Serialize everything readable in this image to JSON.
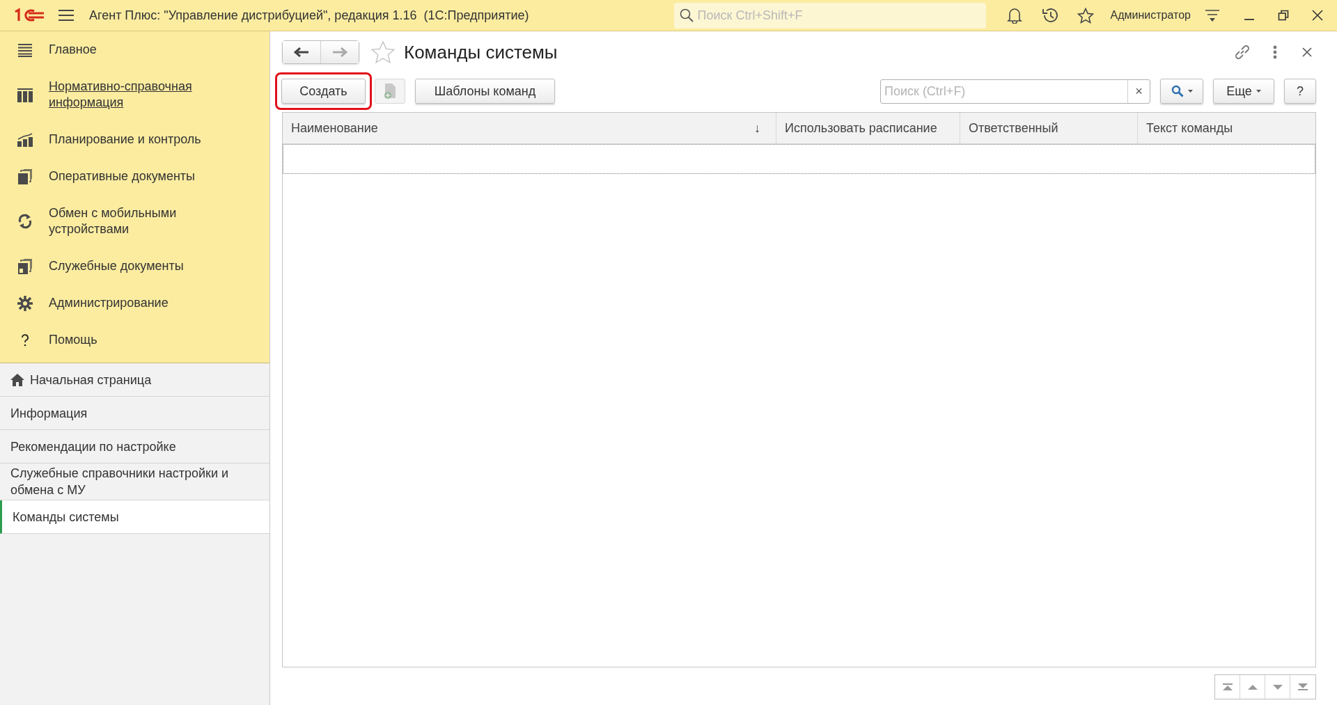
{
  "title_bar": {
    "title": "Агент Плюс: \"Управление дистрибуцией\", редакция 1.16  (1С:Предприятие)",
    "search": {
      "placeholder": "Поиск Ctrl+Shift+F"
    },
    "user": "Администратор"
  },
  "sections": [
    {
      "label": "Главное",
      "hovered": false
    },
    {
      "label": "Нормативно-справочная информация",
      "hovered": true
    },
    {
      "label": "Планирование и контроль",
      "hovered": false
    },
    {
      "label": "Оперативные документы",
      "hovered": false
    },
    {
      "label": "Обмен с мобильными устройствами",
      "hovered": false
    },
    {
      "label": "Служебные документы",
      "hovered": false
    },
    {
      "label": "Администрирование",
      "hovered": false
    },
    {
      "label": "Помощь",
      "hovered": false
    }
  ],
  "open_pages": [
    {
      "kind": "home",
      "label": "Начальная страница",
      "selected": false
    },
    {
      "kind": "page",
      "label": "Информация",
      "selected": false
    },
    {
      "kind": "page",
      "label": "Рекомендации по настройке",
      "selected": false
    },
    {
      "kind": "page",
      "label": "Служебные справочники настройки и обмена с МУ",
      "selected": false
    },
    {
      "kind": "page",
      "label": "Команды системы",
      "selected": true
    }
  ],
  "form": {
    "title": "Команды системы",
    "favorite": false,
    "toolbar": {
      "create": {
        "label": "Создать",
        "highlighted": true
      },
      "templates": "Шаблоны команд",
      "search": {
        "placeholder": "Поиск (Ctrl+F)",
        "clear": "×"
      },
      "more": "Еще",
      "help": "?"
    },
    "table": {
      "columns": [
        {
          "label": "Наименование",
          "sort": "↓"
        },
        {
          "label": "Использовать расписание"
        },
        {
          "label": "Ответственный"
        },
        {
          "label": "Текст команды"
        }
      ]
    }
  }
}
